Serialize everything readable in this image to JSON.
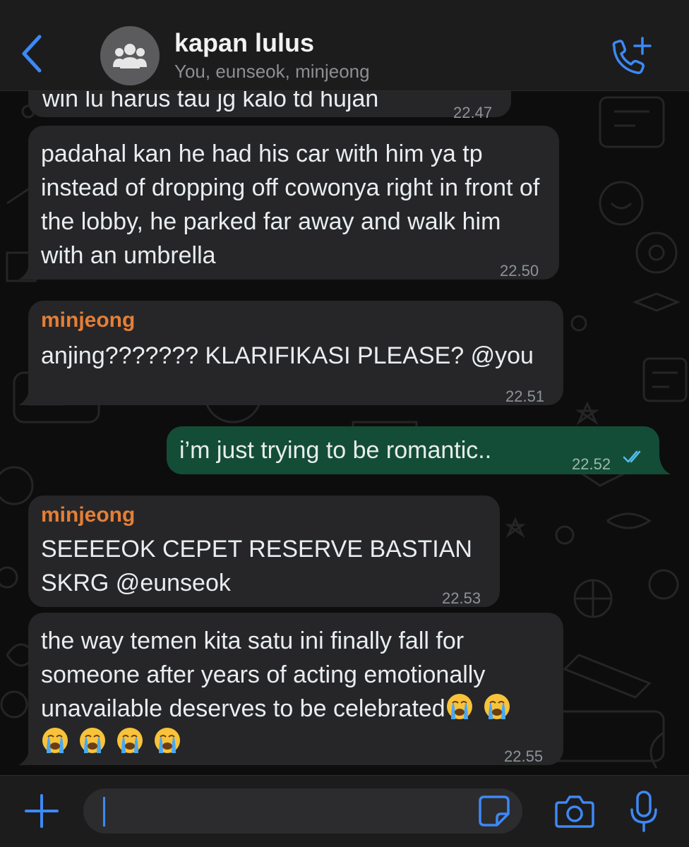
{
  "header": {
    "back_icon": "chevron-left-icon",
    "avatar_icon": "group-icon",
    "title": "kapan lulus",
    "subtitle": "You, eunseok, minjeong",
    "call_icon": "phone-add-icon",
    "accent_color": "#3d89f5"
  },
  "messages": [
    {
      "direction": "incoming",
      "sender": "",
      "text": "win lu harus tau jg kalo td hujan",
      "time": "22.47"
    },
    {
      "direction": "incoming",
      "sender": "",
      "text": "padahal kan he had his car with him ya tp instead of dropping off cowonya right in front of the lobby, he parked far away and walk him with an umbrella",
      "time": "22.50"
    },
    {
      "direction": "incoming",
      "sender": "minjeong",
      "text": "anjing??????? KLARIFIKASI PLEASE? @you",
      "time": "22.51"
    },
    {
      "direction": "outgoing",
      "sender": "",
      "text": "i’m just trying to be romantic..",
      "time": "22.52",
      "status": "read"
    },
    {
      "direction": "incoming",
      "sender": "minjeong",
      "text": "SEEEEOK CEPET RESERVE BASTIAN SKRG @eunseok",
      "time": "22.53"
    },
    {
      "direction": "incoming",
      "sender": "",
      "text": "the way temen kita satu ini finally fall for someone after years of acting emotionally unavailable deserves to be celebrated",
      "emojis": [
        "loudly-crying-face",
        "loudly-crying-face",
        "loudly-crying-face",
        "loudly-crying-face",
        "loudly-crying-face",
        "loudly-crying-face"
      ],
      "time": "22.55"
    }
  ],
  "input_bar": {
    "plus_icon": "plus-icon",
    "message_value": "",
    "sticker_icon": "sticker-icon",
    "camera_icon": "camera-icon",
    "mic_icon": "microphone-icon"
  },
  "colors": {
    "incoming_bubble": "#262628",
    "outgoing_bubble": "#144d37",
    "sender_name": "#e47f37",
    "read_ticks": "#53bdeb"
  }
}
